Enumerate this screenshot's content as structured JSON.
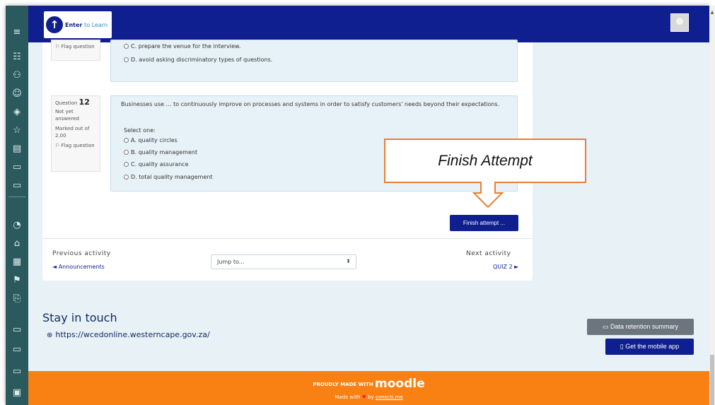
{
  "logo": {
    "text_main": "Enter",
    "text_accent": "to Learn"
  },
  "sidebar": {
    "icons": [
      "menu-icon",
      "list-icon",
      "users-icon",
      "user-icon",
      "layers-icon",
      "star-icon",
      "book-icon",
      "folder-icon",
      "folder-icon",
      "dashboard-icon",
      "home-icon",
      "calendar-icon",
      "graduation-icon",
      "files-icon",
      "folder-icon",
      "folder-icon",
      "folder-icon",
      "lock-icon"
    ],
    "glyphs": [
      "≡",
      "☷",
      "⚇",
      "☺",
      "◈",
      "☆",
      "▤",
      "▭",
      "▭",
      "◔",
      "⌂",
      "▦",
      "⚑",
      "⎘",
      "▭",
      "▭",
      "▭",
      "▣"
    ]
  },
  "q11": {
    "flag": "Flag question",
    "options": [
      {
        "letter": "C.",
        "text": "prepare the venue for the interview."
      },
      {
        "letter": "D.",
        "text": "avoid asking discriminatory types of questions."
      }
    ]
  },
  "q12": {
    "label": "Question",
    "number": "12",
    "status": "Not yet answered",
    "marked": "Marked out of 2.00",
    "flag": "Flag question",
    "text": "Businesses use … to continuously improve on processes and systems in order to satisfy customers' needs beyond their expectations.",
    "select_prompt": "Select one:",
    "options": [
      {
        "letter": "A.",
        "text": "quality circles"
      },
      {
        "letter": "B.",
        "text": "quality management"
      },
      {
        "letter": "C.",
        "text": "quality assurance"
      },
      {
        "letter": "D.",
        "text": "total quality management"
      }
    ]
  },
  "finish_button": "Finish attempt ...",
  "callout": "Finish Attempt",
  "activity_nav": {
    "prev_label": "Previous activity",
    "prev_link": "◄ Announcements",
    "jump_placeholder": "Jump to...",
    "next_label": "Next activity",
    "next_link": "QUIZ 2 ►"
  },
  "footer_section": {
    "title": "Stay in touch",
    "site": "https://wcedonline.westerncape.gov.za/",
    "data_retention": "Data retention summary",
    "mobile_app": "Get the mobile app"
  },
  "footer": {
    "made_prefix": "PROUDLY MADE WITH",
    "brand": "moodle",
    "made_with": "Made with",
    "by": "by",
    "credit": "conecti.me"
  },
  "colors": {
    "navbar": "#0f1f8f",
    "sidebar": "#2b5a5e",
    "footer": "#f98012",
    "callout_border": "#ed7d31"
  }
}
